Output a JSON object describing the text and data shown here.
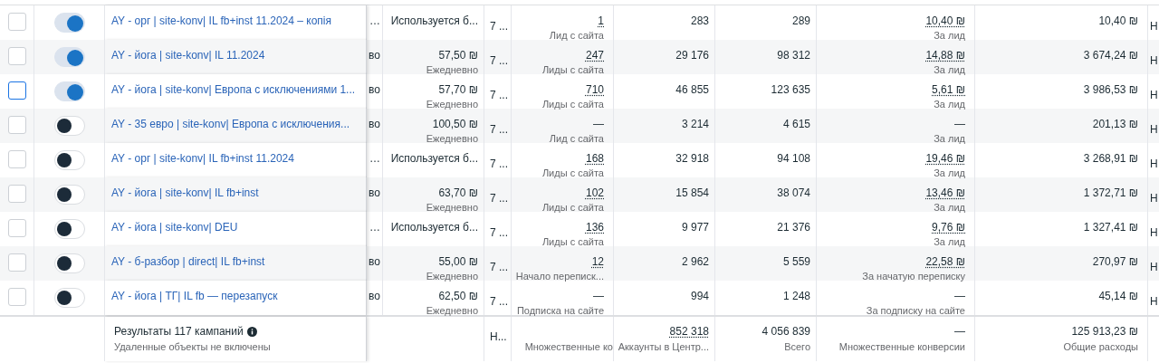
{
  "rows": [
    {
      "checked": false,
      "focused": false,
      "on": true,
      "name": "AY - орг | site-konv| IL fb+inst 11.2024 – копія",
      "column_3": "…",
      "budget": "Используется б...",
      "budget_period": "",
      "attribution": "7 ...",
      "results": "1",
      "results_dotted": true,
      "result_type": "Лид с сайта",
      "reach": "283",
      "impressions": "289",
      "cost_per_result": "10,40 ₪",
      "cost_dotted": true,
      "cost_type": "За лид",
      "spent": "10,40 ₪",
      "column_last": "Н"
    },
    {
      "checked": false,
      "focused": false,
      "on": true,
      "name": "AY - йога | site-konv| IL 11.2024",
      "column_3": "во",
      "budget": "57,50 ₪",
      "budget_period": "Ежедневно",
      "attribution": "7 ...",
      "results": "247",
      "results_dotted": true,
      "result_type": "Лиды с сайта",
      "reach": "29 176",
      "impressions": "98 312",
      "cost_per_result": "14,88 ₪",
      "cost_dotted": true,
      "cost_type": "За лид",
      "spent": "3 674,24 ₪",
      "column_last": "Н"
    },
    {
      "checked": false,
      "focused": true,
      "on": true,
      "name": "AY - йога | site-konv| Европа с исключениями 1...",
      "column_3": "во",
      "budget": "57,70 ₪",
      "budget_period": "Ежедневно",
      "attribution": "7 ...",
      "results": "710",
      "results_dotted": true,
      "result_type": "Лиды с сайта",
      "reach": "46 855",
      "impressions": "123 635",
      "cost_per_result": "5,61 ₪",
      "cost_dotted": true,
      "cost_type": "За лид",
      "spent": "3 986,53 ₪",
      "column_last": "Н"
    },
    {
      "checked": false,
      "focused": false,
      "on": false,
      "name": "AY - 35 евро | site-konv| Европа с исключения...",
      "column_3": "во",
      "budget": "100,50 ₪",
      "budget_period": "Ежедневно",
      "attribution": "7 ...",
      "results": "—",
      "results_dotted": false,
      "result_type": "Лид с сайта",
      "reach": "3 214",
      "impressions": "4 615",
      "cost_per_result": "—",
      "cost_dotted": false,
      "cost_type": "За лид",
      "spent": "201,13 ₪",
      "column_last": "Н"
    },
    {
      "checked": false,
      "focused": false,
      "on": false,
      "name": "AY - орг | site-konv| IL fb+inst 11.2024",
      "column_3": "…",
      "budget": "Используется б...",
      "budget_period": "",
      "attribution": "7 ...",
      "results": "168",
      "results_dotted": true,
      "result_type": "Лиды с сайта",
      "reach": "32 918",
      "impressions": "94 108",
      "cost_per_result": "19,46 ₪",
      "cost_dotted": true,
      "cost_type": "За лид",
      "spent": "3 268,91 ₪",
      "column_last": "Н"
    },
    {
      "checked": false,
      "focused": false,
      "on": false,
      "name": "AY - йога | site-konv| IL fb+inst",
      "column_3": "во",
      "budget": "63,70 ₪",
      "budget_period": "Ежедневно",
      "attribution": "7 ...",
      "results": "102",
      "results_dotted": true,
      "result_type": "Лиды с сайта",
      "reach": "15 854",
      "impressions": "38 074",
      "cost_per_result": "13,46 ₪",
      "cost_dotted": true,
      "cost_type": "За лид",
      "spent": "1 372,71 ₪",
      "column_last": "Н"
    },
    {
      "checked": false,
      "focused": false,
      "on": false,
      "name": "AY - йога | site-konv| DEU",
      "column_3": "…",
      "budget": "Используется б...",
      "budget_period": "",
      "attribution": "7 ...",
      "results": "136",
      "results_dotted": true,
      "result_type": "Лиды с сайта",
      "reach": "9 977",
      "impressions": "21 376",
      "cost_per_result": "9,76 ₪",
      "cost_dotted": true,
      "cost_type": "За лид",
      "spent": "1 327,41 ₪",
      "column_last": "Н"
    },
    {
      "checked": false,
      "focused": false,
      "on": false,
      "name": "AY - б-разбор | direct| IL fb+inst",
      "column_3": "во",
      "budget": "55,00 ₪",
      "budget_period": "Ежедневно",
      "attribution": "7 ...",
      "results": "12",
      "results_dotted": true,
      "result_type": "Начало переписк...",
      "reach": "2 962",
      "impressions": "5 559",
      "cost_per_result": "22,58 ₪",
      "cost_dotted": true,
      "cost_type": "За начатую переписку",
      "spent": "270,97 ₪",
      "column_last": "Н"
    },
    {
      "checked": false,
      "focused": false,
      "on": false,
      "name": "AY - йога | ТГ| IL fb — перезапуск",
      "column_3": "во",
      "budget": "62,50 ₪",
      "budget_period": "Ежедневно",
      "attribution": "7 ...",
      "results": "—",
      "results_dotted": false,
      "result_type": "Подписка на сайте",
      "reach": "994",
      "impressions": "1 248",
      "cost_per_result": "—",
      "cost_dotted": false,
      "cost_type": "За подписку на сайте",
      "spent": "45,14 ₪",
      "column_last": "Н"
    }
  ],
  "summary": {
    "title": "Результаты 117 кампаний",
    "note": "Удаленные объекты не включены",
    "attribution": "Н...",
    "results_type": "Множественные ко",
    "reach": "852 318",
    "reach_type": "Аккаунты в Центр...",
    "impressions": "4 056 839",
    "impressions_type": "Всего",
    "cost_per_result": "—",
    "cost_type": "Множественные конверсии",
    "spent": "125 913,23 ₪",
    "spent_type": "Общие расходы"
  }
}
